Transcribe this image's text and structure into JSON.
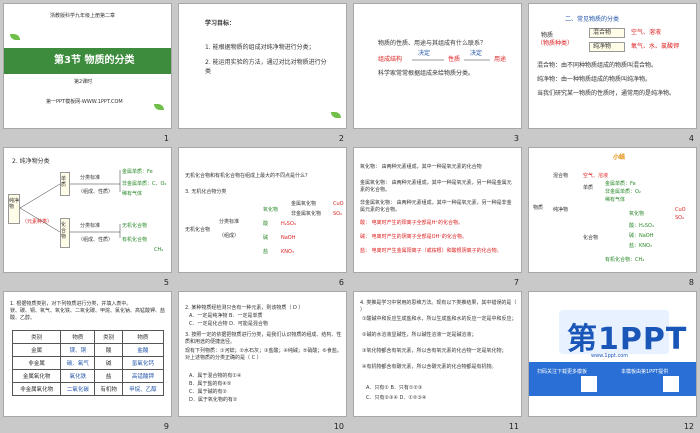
{
  "slides": [
    {
      "number": "1",
      "header": "浙教版科学九年级上册第二章",
      "title": "第3节  物质的分类",
      "subtitle": "第2课时",
      "footer": "第一PPT模板网-WWW.1PPT.COM"
    },
    {
      "number": "2",
      "heading": "学习目标：",
      "goal1": "1. 能根据物质的组成对纯净物进行分类；",
      "goal2": "2. 能运用实验的方法，通过对比对物质进行分类"
    },
    {
      "number": "3",
      "q": "物质的性质、用途与其组成有什么联系？",
      "a1": "组成结构",
      "a2": "决定",
      "a3": "性质",
      "a4": "决定",
      "a5": "用途",
      "note": "科学家常常根据组成来给物质分类。"
    },
    {
      "number": "4",
      "h": "二、常见物质的分类",
      "l1": "物质",
      "l2": "（物质种类）",
      "m1": "混合物",
      "m2": "纯净物",
      "r1": "空气、溶液",
      "r2": "氧气、水、氯酸钾",
      "d1": "混合物：由不同种物质组成的物质叫混合物。",
      "d2": "纯净物：由一种物质组成的物质叫纯净物。",
      "d3": "当我们研究某一物质的性质时，通常用的是纯净物。"
    },
    {
      "number": "5",
      "h": "2. 纯净物分类",
      "l": "纯净物",
      "sub": "（元素种类）",
      "b1": "单质",
      "b2": "化合物",
      "c1": "分类标准",
      "c2": "（组成、性质）",
      "c3": "分类标准",
      "c4": "（组成、性质）",
      "e1": "金属单质：Fe",
      "e2": "非金属单质：C、O₂",
      "e3": "稀有气体",
      "e4": "无机化合物",
      "e5": "有机化合物",
      "e6": "CH₄"
    },
    {
      "number": "6",
      "q": "无机化合物和有机化合物在组成上最大的不同点是什么？",
      "h": "3. 无机化合物分类",
      "l": "无机化合物",
      "c1": "分类标准",
      "c2": "（组成）",
      "o1": "氧化物",
      "o2": "酸",
      "o3": "碱",
      "o4": "盐",
      "x1": "H₂SO₄",
      "x2": "NaOH",
      "x3": "KNO₃",
      "x4": "金属氧化物",
      "x5": "非金属氧化物",
      "x6": "CuO",
      "x7": "SO₂"
    },
    {
      "number": "7",
      "l1": "氧化物：  由两种元素组成，其中一种是氧元素的化合物",
      "l2": "金属氧化物：  由两种元素组成，其中一种是氧元素，另一种是金属元素的化合物。",
      "l3": "非金属氧化物：  由两种元素组成，其中一种是氧元素，另一种是非金属元素的化合物。",
      "l4": "酸：  电离时产生的阳离子全部是H⁺的化合物。",
      "l5": "碱：  电离时产生的阴离子全部是OH⁻的化合物。",
      "l6": "盐：  电离时产生金属阳离子（或铵根）和酸根阴离子的化合物。"
    },
    {
      "number": "8",
      "tag": "小结",
      "l": "物质",
      "a": "混合物",
      "b": "纯净物",
      "c": "单质",
      "d": "化合物",
      "e1": "空气、溶液",
      "e2": "金属单质：Fe",
      "e3": "非金属单质：O₂",
      "e4": "稀有气体",
      "e5": "氧化物",
      "e6": "酸：H₂SO₄",
      "e7": "碱：NaOH",
      "e8": "盐：KNO₃",
      "e9": "CuO",
      "e10": "SO₂",
      "e11": "有机化合物：CH₄"
    },
    {
      "number": "9",
      "q": "1. 根据物质类别，对下列物质进行分类，并填入表中。",
      "items": "镁、碳、铜、氧气、氧化铁、二氧化碳、甲烷、氯化钠、高锰酸钾、盐酸、乙醇。",
      "table": [
        [
          "类别",
          "物质",
          "类别",
          "物质"
        ],
        [
          "金属",
          "镁、铜",
          "酸",
          "盐酸"
        ],
        [
          "非金属",
          "碳、氧气",
          "碱",
          "氢氧化钙"
        ],
        [
          "金属氧化物",
          "氧化铁",
          "盐",
          "高锰酸钾"
        ],
        [
          "非金属氧化物",
          "二氧化碳",
          "有机物",
          "甲烷、乙醇"
        ]
      ]
    },
    {
      "number": "10",
      "q1": "2. 某种物质经检测只含有一种元素，则该物质（  D  ）",
      "o1": "A．一定是纯净物        B．一定是单质",
      "o2": "C．一定是化合物        D．可能是混合物",
      "q2": "3. 按照一定的依据把物质进行分类，是我们认识物质的组成、结构、性质和用途的便捷途径。",
      "q3": "现有下列物质：①河蚌；②水石灰；③盐酸；④纯碱；⑤硝酸；⑥食盐。对上述物质的分类正确的是（  C  ）",
      "o3": "A．属于混合物的有①④",
      "o4": "B．属于盐的有④⑤",
      "o5": "C．属于碱的有②",
      "o6": "D．属于氧化物的有②"
    },
    {
      "number": "11",
      "q": "4. 类推是学习中常用的思维方法。现有以下类推结果，其中错误的是（      ）",
      "o1": "①酸碱中和反应生成盐和水，所以生成盐和水的反应一定是中和反应；",
      "o2": "②碱的水溶液显碱性，所以碱性溶液一定是碱溶液；",
      "o3": "③氧化物都含有氧元素，所以含有氧元素的化合物一定是氧化物；",
      "o4": "④有机物都含有碳元素，所以含碳元素的化合物都是有机物。",
      "a": "A．只有①       B．只有①②③",
      "b": "C．只有②③④    D．①②③④"
    },
    {
      "number": "12",
      "logo": "第1PPT",
      "url": "www.1ppt.com",
      "left_text": "扫码关注下载更多模板",
      "right_text": "本模板由第1PPT提供"
    }
  ]
}
